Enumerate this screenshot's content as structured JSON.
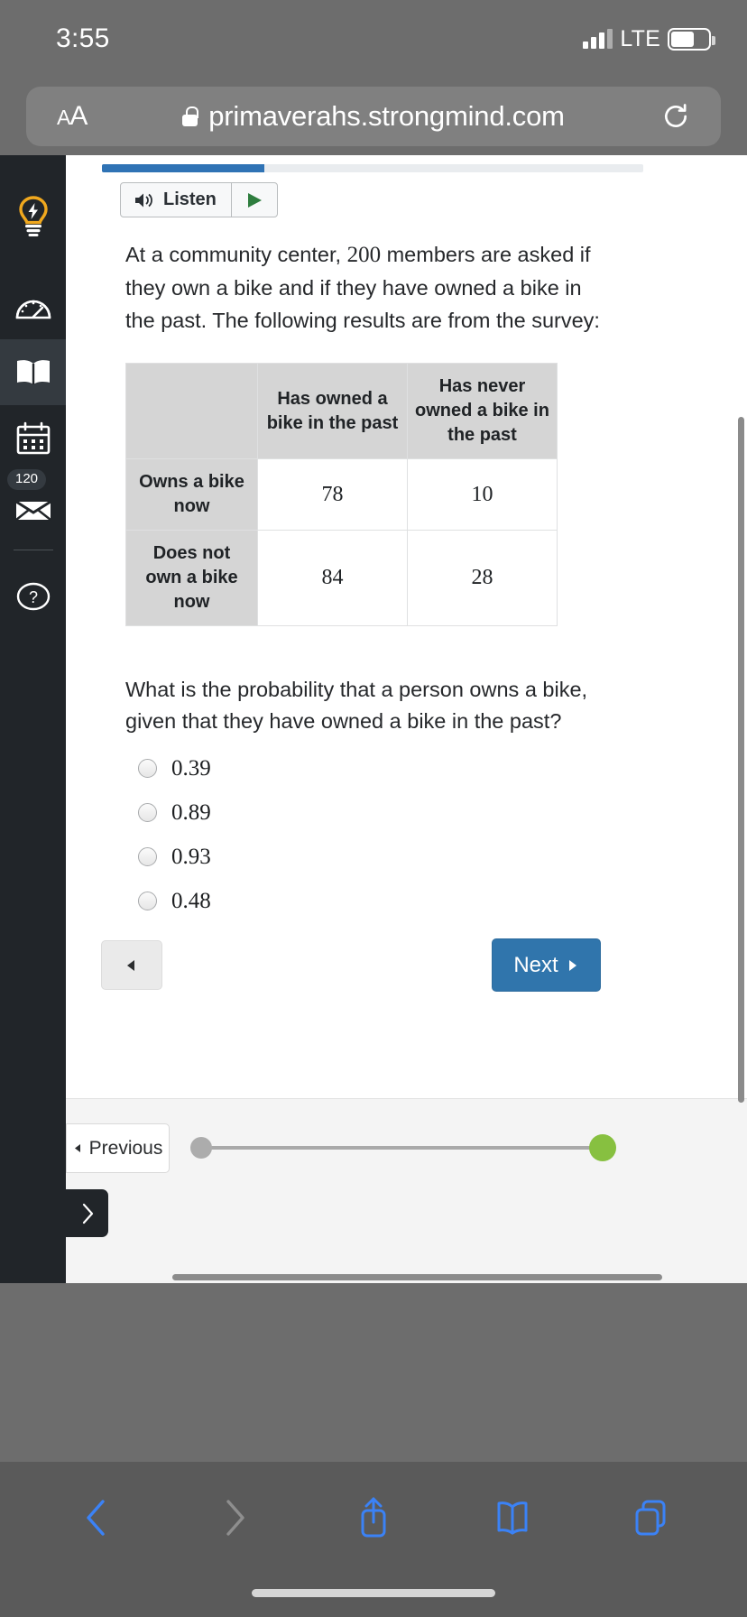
{
  "status_bar": {
    "time": "3:55",
    "network": "LTE",
    "signal_icon": "cellular-signal-icon",
    "battery_icon": "battery-icon"
  },
  "browser": {
    "text_size_label": "AA",
    "lock_icon": "lock-icon",
    "url": "primaverahs.strongmind.com",
    "reload_icon": "reload-icon",
    "toolbar": [
      {
        "name": "back-button",
        "icon": "chevron-left-icon",
        "enabled": true
      },
      {
        "name": "forward-button",
        "icon": "chevron-right-icon",
        "enabled": false
      },
      {
        "name": "share-button",
        "icon": "share-icon",
        "enabled": true
      },
      {
        "name": "bookmarks-button",
        "icon": "book-icon",
        "enabled": true
      },
      {
        "name": "tabs-button",
        "icon": "tabs-icon",
        "enabled": true
      }
    ]
  },
  "lms_sidebar": {
    "items": [
      {
        "name": "sidebar-item-ideas",
        "icon": "lightbulb-icon",
        "active": false,
        "badge": ""
      },
      {
        "name": "sidebar-item-dashboard",
        "icon": "speedometer-icon",
        "active": false,
        "badge": ""
      },
      {
        "name": "sidebar-item-courses",
        "icon": "book-icon",
        "active": true,
        "badge": ""
      },
      {
        "name": "sidebar-item-calendar",
        "icon": "calendar-icon",
        "active": false,
        "badge": ""
      },
      {
        "name": "sidebar-item-inbox",
        "icon": "envelope-icon",
        "active": false,
        "badge": "120"
      },
      {
        "name": "sidebar-item-help",
        "icon": "question-circle-icon",
        "active": false,
        "badge": ""
      }
    ]
  },
  "lesson": {
    "progress_percent": 30,
    "listen_label": "Listen",
    "speaker_icon": "speaker-icon",
    "play_icon": "play-icon",
    "passage_part1": "At a community center,",
    "passage_number": "200",
    "passage_part2": "members are asked if they own a bike and if they have owned a bike in the past. The following results are from the survey:",
    "table": {
      "corner_header": "",
      "column_headers": [
        "Has owned a bike in the past",
        "Has never owned a bike in the past"
      ],
      "rows": [
        {
          "label": "Owns a bike now",
          "values": [
            "78",
            "10"
          ]
        },
        {
          "label": "Does not own a bike now",
          "values": [
            "84",
            "28"
          ]
        }
      ]
    },
    "question": "What is the probability that a person owns a bike, given that they have owned a bike in the past?",
    "options": [
      {
        "label": "0.39",
        "selected": false
      },
      {
        "label": "0.89",
        "selected": false
      },
      {
        "label": "0.93",
        "selected": false
      },
      {
        "label": "0.48",
        "selected": false
      }
    ],
    "back_button_icon": "triangle-left-icon",
    "next_button_label": "Next",
    "next_button_icon": "triangle-right-icon",
    "previous_button_label": "Previous",
    "previous_button_icon": "triangle-left-icon",
    "expander_icon": "chevron-right-icon"
  },
  "colors": {
    "accent_blue": "#3075ac",
    "progress_blue": "#2f73b5",
    "sidebar_dark": "#212529",
    "green_dot": "#87c040",
    "header_gray": "#d5d5d5",
    "safari_chrome": "#6d6d6d",
    "ios_blue": "#3b82f6"
  },
  "chart_data": {
    "type": "table",
    "title": "Bike ownership survey two-way frequency table",
    "total_members": 200,
    "row_categories": [
      "Owns a bike now",
      "Does not own a bike now"
    ],
    "column_categories": [
      "Has owned a bike in the past",
      "Has never owned a bike in the past"
    ],
    "values": [
      [
        78,
        10
      ],
      [
        84,
        28
      ]
    ]
  }
}
